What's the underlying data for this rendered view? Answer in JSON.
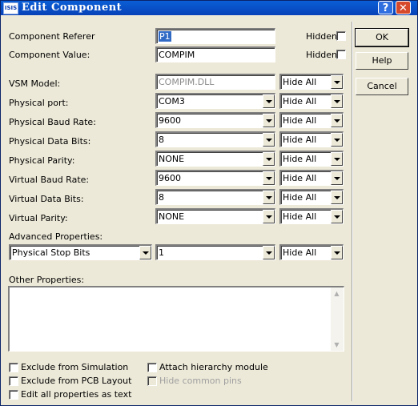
{
  "window": {
    "title": "Edit Component",
    "icon_text": "ISIS"
  },
  "titlebar": {
    "help_label": "?",
    "close_label": "✕"
  },
  "fields": {
    "referer": {
      "label": "Component Referer",
      "value": "P1",
      "hidden_label": "Hidden:"
    },
    "value": {
      "label": "Component Value:",
      "value": "COMPIM",
      "hidden_label": "Hidden:"
    }
  },
  "rows": [
    {
      "label": "VSM Model:",
      "value": "COMPIM.DLL",
      "hide": "Hide All"
    },
    {
      "label": "Physical port:",
      "value": "COM3",
      "hide": "Hide All"
    },
    {
      "label": "Physical Baud Rate:",
      "value": "9600",
      "hide": "Hide All"
    },
    {
      "label": "Physical Data Bits:",
      "value": "8",
      "hide": "Hide All"
    },
    {
      "label": "Physical Parity:",
      "value": "NONE",
      "hide": "Hide All"
    },
    {
      "label": "Virtual Baud Rate:",
      "value": "9600",
      "hide": "Hide All"
    },
    {
      "label": "Virtual Data Bits:",
      "value": "8",
      "hide": "Hide All"
    },
    {
      "label": "Virtual Parity:",
      "value": "NONE",
      "hide": "Hide All"
    }
  ],
  "advanced": {
    "label": "Advanced Properties:",
    "property": "Physical Stop Bits",
    "value": "1",
    "hide": "Hide All"
  },
  "other": {
    "label": "Other Properties:"
  },
  "checkboxes": {
    "exclude_sim": "Exclude from Simulation",
    "exclude_pcb": "Exclude from PCB Layout",
    "edit_all": "Edit all properties as text",
    "attach_hier": "Attach hierarchy module",
    "hide_pins": "Hide common pins"
  },
  "buttons": {
    "ok": "OK",
    "help": "Help",
    "cancel": "Cancel"
  }
}
